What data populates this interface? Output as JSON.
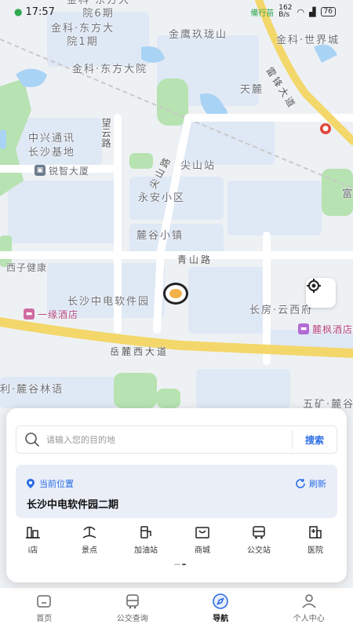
{
  "status_bar": {
    "time": "17:57",
    "network_speed": "162\nB/s",
    "battery": "76"
  },
  "map": {
    "labels": {
      "jinke_dfd_6": "金科·东方大\n院6期",
      "jinke_dfd_1": "金科·东方大\n院1期",
      "jinke_dfd": "金科·东方大院",
      "jinying": "金鹰玖珑山",
      "jinke_shijie": "金科·世界城",
      "tianlu": "天麓",
      "leifeng": "雷锋大道",
      "zhongxing": "中兴通讯\n长沙基地",
      "wangyun": "望云路",
      "ruizhi": "锐智大厦",
      "jianshan_road": "尖山路",
      "jianshan_station": "尖山站",
      "yongan": "永安小区",
      "lugu": "麓谷小镇",
      "qingshan": "青山路",
      "xizi": "西子健康",
      "csdz": "长沙中电软件园",
      "yiyuan": "一缘酒店",
      "changfang": "长房·云西府",
      "lufeng": "麓枫酒店",
      "yuelu": "岳麓西大道",
      "lugu_linyu": "利·麓谷林语",
      "wukuang": "五矿·麓谷",
      "fuzhu": "富"
    },
    "top_poi": "備行苗"
  },
  "panel": {
    "search": {
      "placeholder": "请输入您的目的地",
      "button": "搜索"
    },
    "location": {
      "label": "当前位置",
      "refresh": "刷新",
      "name": "长沙中电软件园二期"
    },
    "quick_links": [
      {
        "label": "i店",
        "icon": "hotel-icon"
      },
      {
        "label": "景点",
        "icon": "scenic-icon"
      },
      {
        "label": "加油站",
        "icon": "gas-station-icon"
      },
      {
        "label": "商城",
        "icon": "mall-icon"
      },
      {
        "label": "公交站",
        "icon": "bus-stop-icon"
      },
      {
        "label": "医院",
        "icon": "hospital-icon"
      }
    ]
  },
  "tabs": [
    {
      "label": "首页",
      "icon": "home-icon"
    },
    {
      "label": "公交查询",
      "icon": "bus-icon"
    },
    {
      "label": "导航",
      "icon": "compass-icon"
    },
    {
      "label": "个人中心",
      "icon": "user-icon"
    }
  ],
  "colors": {
    "accent": "#2b6de5",
    "road_yellow": "#f3d76a",
    "water": "#a9d3f5",
    "green": "#b7e2b1",
    "block": "#dfe8f5"
  }
}
